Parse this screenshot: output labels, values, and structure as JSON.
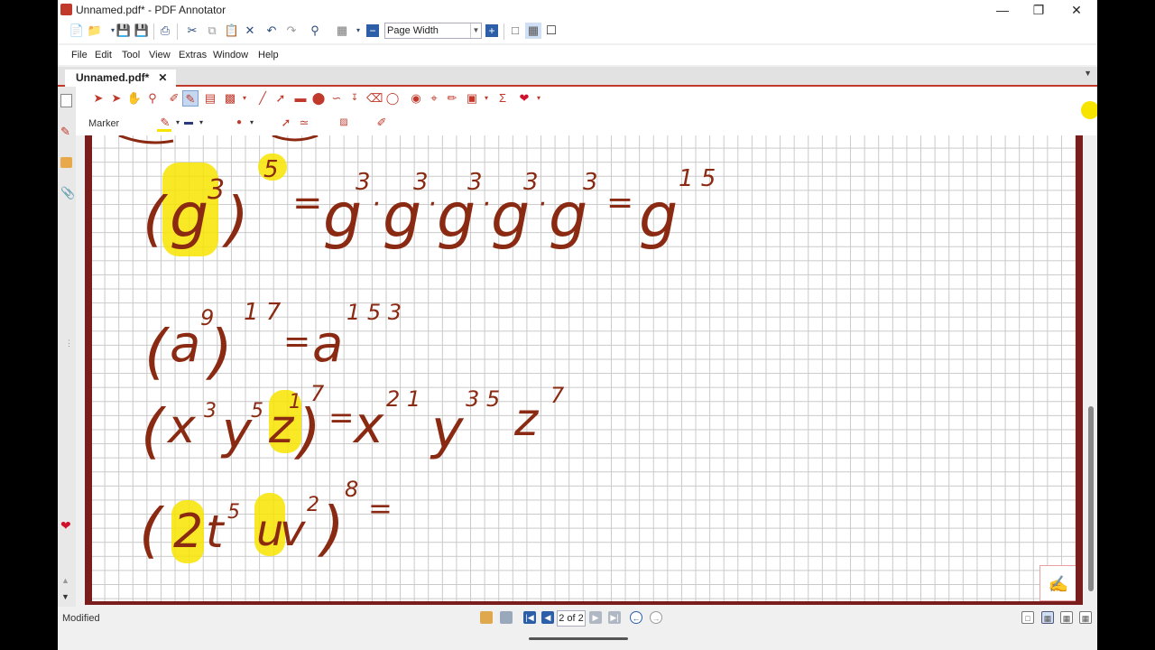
{
  "window": {
    "title": "Unnamed.pdf* - PDF Annotator"
  },
  "toolbar": {
    "zoom_value": "Page Width"
  },
  "menus": [
    "File",
    "Edit",
    "Tool",
    "View",
    "Extras",
    "Window",
    "Help"
  ],
  "tab": {
    "label": "Unnamed.pdf*",
    "close": "✕"
  },
  "annotation_toolbar": {
    "current_tool_label": "Marker",
    "highlight_color": "#f7e400",
    "pen_color": "#8b1a0c"
  },
  "document": {
    "ink_color": "#8b2a12",
    "highlight_color": "#f7e400",
    "equations": [
      {
        "lhs": "(g³)⁵",
        "rhs": "= g³·g³·g³·g³·g³ = g¹⁵"
      },
      {
        "lhs": "(a⁹)¹⁷",
        "rhs": "= a¹⁵³"
      },
      {
        "lhs": "(x³y⁵z¹)⁷",
        "rhs": "= x²¹ y³⁵ z⁷"
      },
      {
        "lhs": "(2t⁵uv²)⁸",
        "rhs": "="
      }
    ]
  },
  "status": {
    "text": "Modified",
    "page_indicator": "2 of 2"
  }
}
